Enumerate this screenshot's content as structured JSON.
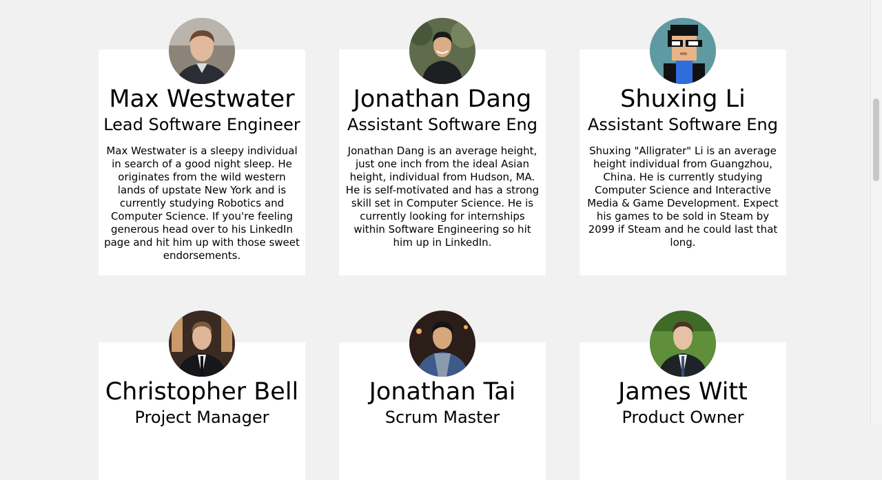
{
  "team": [
    {
      "name": "Max Westwater",
      "role": "Lead Software Engineer",
      "bio": "Max Westwater is a sleepy individual in search of a good night sleep. He originates from the wild western lands of upstate New York and is currently studying Robotics and Computer Science. If you're feeling generous head over to his LinkedIn page and hit him up with those sweet endorsements."
    },
    {
      "name": "Jonathan Dang",
      "role": "Assistant Software Eng",
      "bio": "Jonathan Dang is an average height, just one inch from the ideal Asian height, individual from Hudson, MA. He is self-motivated and has a strong skill set in Computer Science. He is currently looking for internships within Software Engineering so hit him up in LinkedIn."
    },
    {
      "name": "Shuxing Li",
      "role": "Assistant Software Eng",
      "bio": "Shuxing \"Alligrater\" Li is an average height individual from Guangzhou, China. He is currently studying Computer Science and Interactive Media & Game Development. Expect his games to be sold in Steam by 2099 if Steam and he could last that long."
    },
    {
      "name": "Christopher Bell",
      "role": "Project Manager",
      "bio": ""
    },
    {
      "name": "Jonathan Tai",
      "role": "Scrum Master",
      "bio": ""
    },
    {
      "name": "James Witt",
      "role": "Product Owner",
      "bio": ""
    }
  ],
  "colors": {
    "page_background": "#f1f1f1",
    "card_background": "#ffffff",
    "text": "#000000"
  }
}
